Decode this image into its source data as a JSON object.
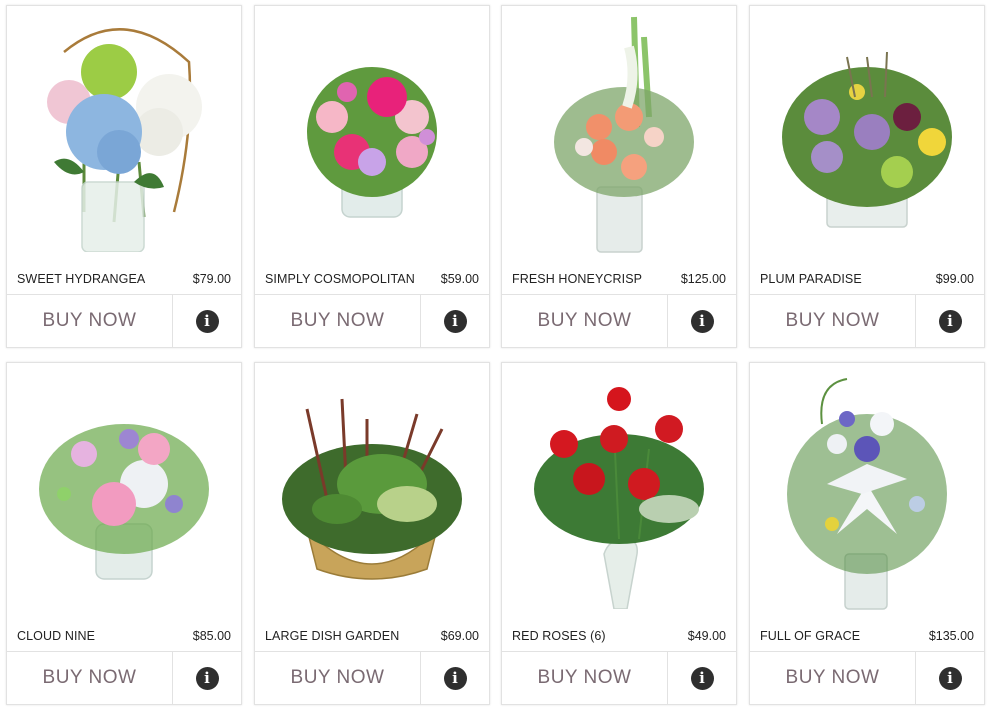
{
  "products": [
    {
      "name": "SWEET HYDRANGEA",
      "price": "$79.00",
      "buy_label": "BUY NOW",
      "info_icon": "info-circle-icon",
      "image": "hydrangea-bouquet"
    },
    {
      "name": "SIMPLY COSMOPOLITAN",
      "price": "$59.00",
      "buy_label": "BUY NOW",
      "info_icon": "info-circle-icon",
      "image": "pink-rose-bouquet"
    },
    {
      "name": "FRESH HONEYCRISP",
      "price": "$125.00",
      "buy_label": "BUY NOW",
      "info_icon": "info-circle-icon",
      "image": "peach-rose-tall-arrangement"
    },
    {
      "name": "PLUM PARADISE",
      "price": "$99.00",
      "buy_label": "BUY NOW",
      "info_icon": "info-circle-icon",
      "image": "purple-rose-cube-arrangement"
    },
    {
      "name": "CLOUD NINE",
      "price": "$85.00",
      "buy_label": "BUY NOW",
      "info_icon": "info-circle-icon",
      "image": "pastel-garden-bouquet"
    },
    {
      "name": "LARGE DISH GARDEN",
      "price": "$69.00",
      "buy_label": "BUY NOW",
      "info_icon": "info-circle-icon",
      "image": "basket-dish-garden"
    },
    {
      "name": "RED ROSES (6)",
      "price": "$49.00",
      "buy_label": "BUY NOW",
      "info_icon": "info-circle-icon",
      "image": "red-roses-vase"
    },
    {
      "name": "FULL OF GRACE",
      "price": "$135.00",
      "buy_label": "BUY NOW",
      "info_icon": "info-circle-icon",
      "image": "white-lily-arrangement"
    }
  ],
  "colors": {
    "text": "#222222",
    "buy_text": "#7a6a72",
    "border": "#e2e2e2",
    "info_icon": "#2f2f2f"
  }
}
